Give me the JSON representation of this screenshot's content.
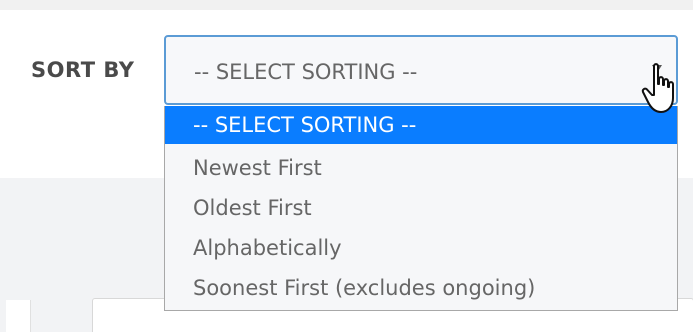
{
  "sort": {
    "label": "SORT BY",
    "selected_value": "-- SELECT SORTING --",
    "options": [
      "-- SELECT SORTING --",
      "Newest First",
      "Oldest First",
      "Alphabetically",
      "Soonest First (excludes ongoing)"
    ]
  },
  "colors": {
    "focus_border": "#5b9bd5",
    "highlight": "#0a7dff"
  },
  "icons": {
    "arrow": "chevron-down-icon",
    "pointer": "hand-cursor-icon"
  }
}
